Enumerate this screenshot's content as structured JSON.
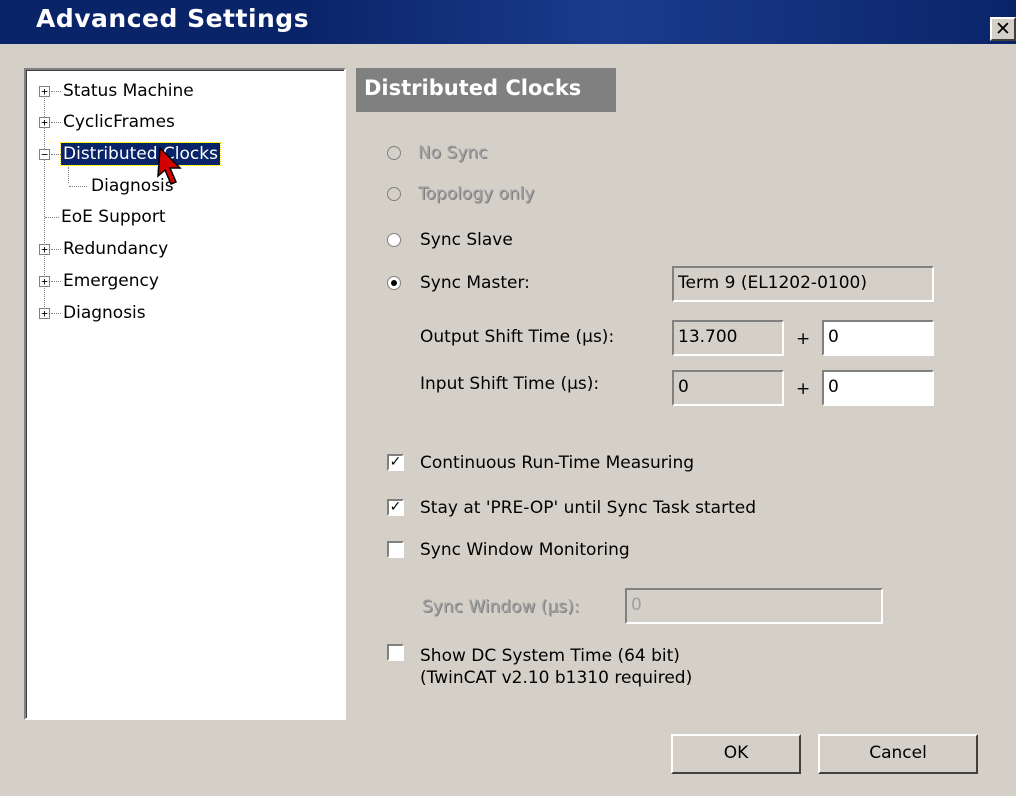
{
  "window": {
    "title": "Advanced Settings",
    "close_glyph": "✕"
  },
  "tree": {
    "items": [
      {
        "label": "Status Machine",
        "expander": "+",
        "level": 0
      },
      {
        "label": "CyclicFrames",
        "expander": "+",
        "level": 0
      },
      {
        "label": "Distributed Clocks",
        "expander": "−",
        "level": 0,
        "selected": true
      },
      {
        "label": "Diagnosis",
        "expander": "",
        "level": 1
      },
      {
        "label": "EoE Support",
        "expander": "",
        "level": 0
      },
      {
        "label": "Redundancy",
        "expander": "+",
        "level": 0
      },
      {
        "label": "Emergency",
        "expander": "+",
        "level": 0
      },
      {
        "label": "Diagnosis",
        "expander": "+",
        "level": 0
      }
    ]
  },
  "panel": {
    "title": "Distributed Clocks",
    "radios": {
      "no_sync": "No Sync",
      "topology_only": "Topology only",
      "sync_slave": "Sync Slave",
      "sync_master": "Sync Master:"
    },
    "sync_master_value": "Term 9 (EL1202-0100)",
    "output_shift_label": "Output Shift Time (µs):",
    "output_shift_value": "13.700",
    "output_shift_add": "0",
    "input_shift_label": "Input Shift Time (µs):",
    "input_shift_value": "0",
    "input_shift_add": "0",
    "plus": "+",
    "checks": {
      "continuous": {
        "label": "Continuous Run-Time Measuring",
        "checked": true
      },
      "stay_preop": {
        "label": "Stay at 'PRE-OP' until Sync Task started",
        "checked": true
      },
      "sync_window": {
        "label": "Sync Window Monitoring",
        "checked": false
      },
      "show_dc": {
        "label": "Show DC System Time (64 bit)",
        "label2": "(TwinCAT  v2.10 b1310 required)",
        "checked": false
      }
    },
    "sync_window_label": "Sync Window (µs):",
    "sync_window_value": "0",
    "check_glyph": "✓"
  },
  "buttons": {
    "ok": "OK",
    "cancel": "Cancel"
  },
  "colors": {
    "titlebar": "#0a246a",
    "selection": "#0a246a",
    "face": "#d4d0c8"
  }
}
